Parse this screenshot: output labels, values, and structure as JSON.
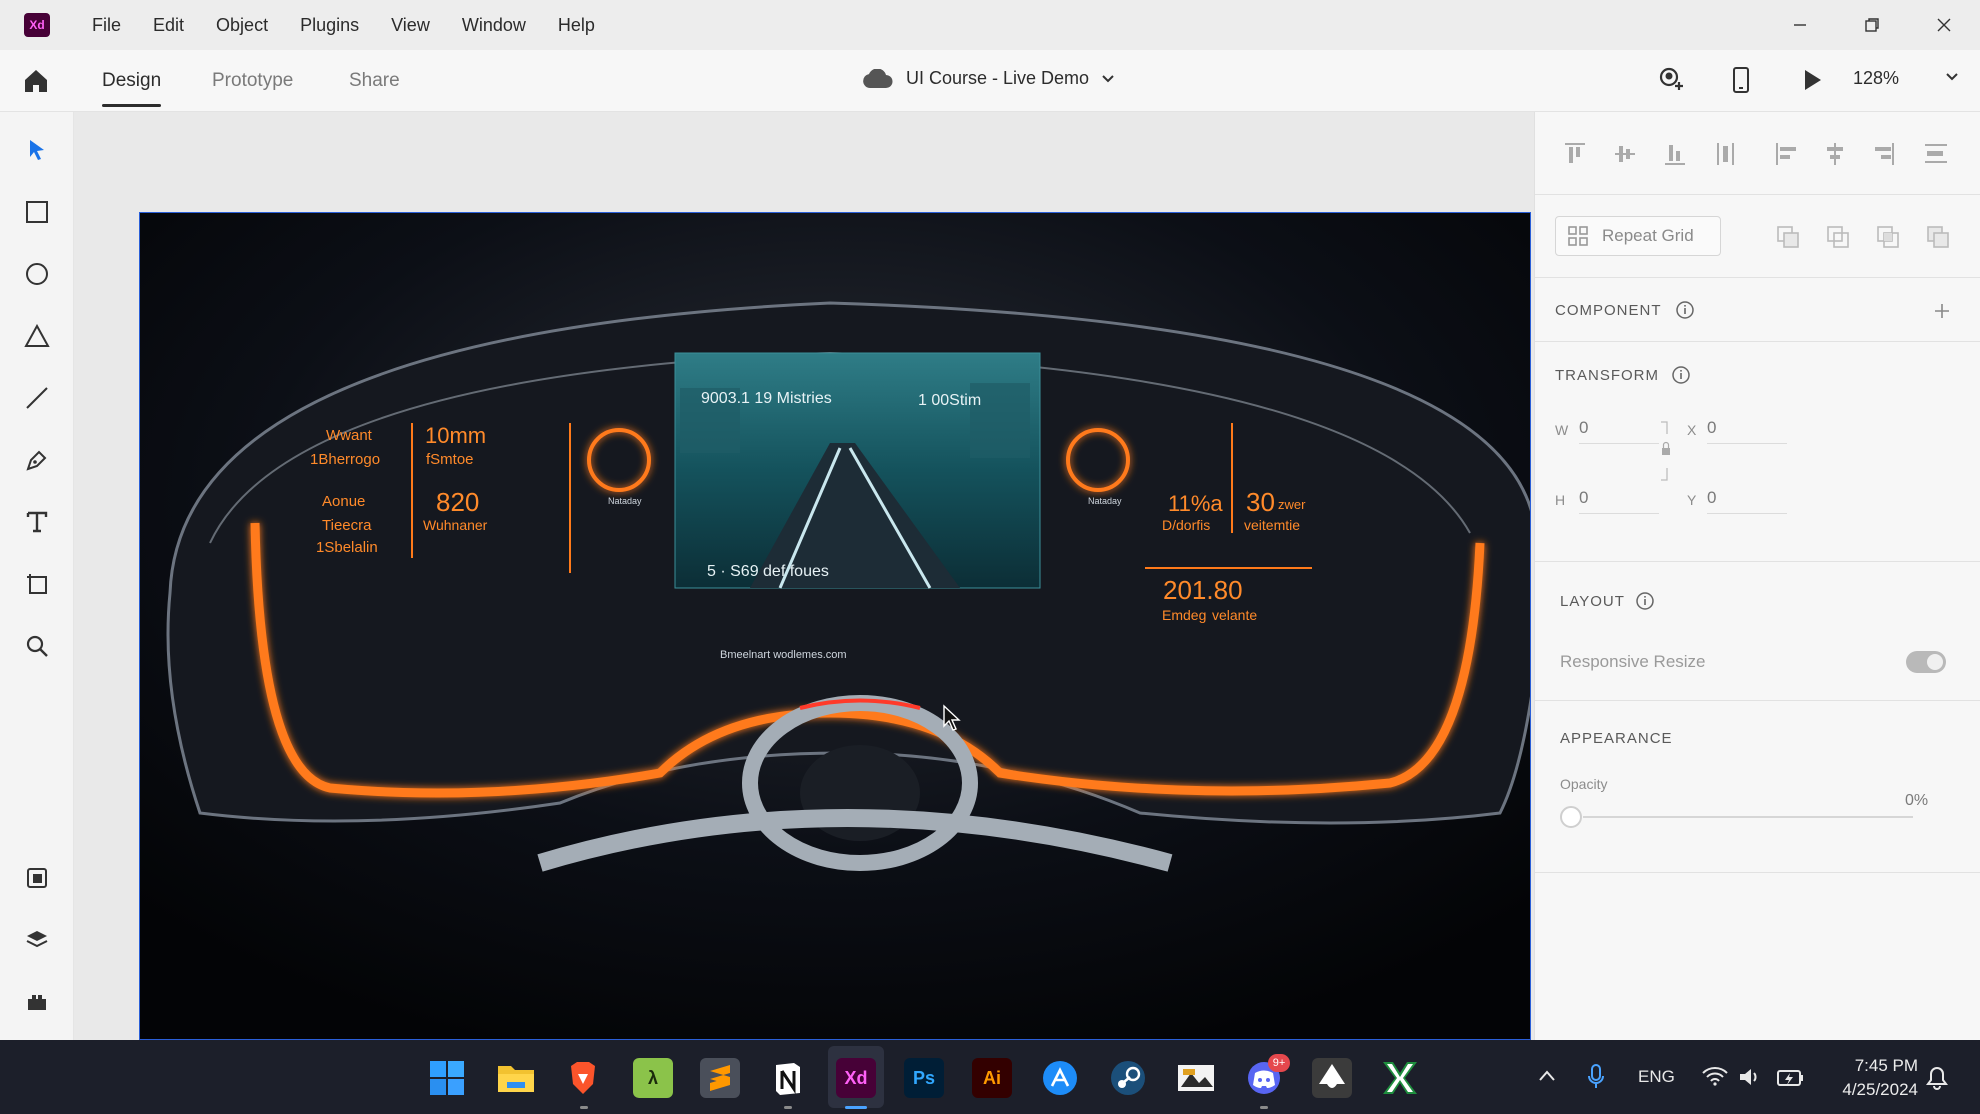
{
  "app": {
    "logo_text": "Xd"
  },
  "menu": [
    "File",
    "Edit",
    "Object",
    "Plugins",
    "View",
    "Window",
    "Help"
  ],
  "header": {
    "tabs": [
      "Design",
      "Prototype",
      "Share"
    ],
    "active_tab": "Design",
    "document_title": "UI Course - Live Demo",
    "zoom": "128%"
  },
  "tools": [
    "select-tool",
    "rectangle-tool",
    "ellipse-tool",
    "polygon-tool",
    "line-tool",
    "pen-tool",
    "text-tool",
    "artboard-tool",
    "zoom-tool",
    "assets",
    "layers",
    "plugins"
  ],
  "panel": {
    "repeat_grid": "Repeat Grid",
    "component_title": "COMPONENT",
    "transform_title": "TRANSFORM",
    "w_label": "W",
    "w_value": "0",
    "h_label": "H",
    "h_value": "0",
    "x_label": "X",
    "x_value": "0",
    "y_label": "Y",
    "y_value": "0",
    "layout_title": "LAYOUT",
    "responsive_resize": "Responsive Resize",
    "appearance_title": "APPEARANCE",
    "opacity_label": "Opacity",
    "opacity_value": "0%"
  },
  "artboard": {
    "hud_left_1": "Wwant",
    "hud_left_2": "1Bherrogo",
    "hud_left_3": "10mm",
    "hud_left_4": "fSmtoe",
    "hud_left_5": "Aonue",
    "hud_left_6": "Tieecra",
    "hud_left_7": "1Sbelalin",
    "hud_left_8": "820",
    "hud_left_9": "Wuhnaner",
    "gauge_left_label": "Nataday",
    "gauge_right_label": "Nataday",
    "screen_top_left": "9003.1 19 Mistries",
    "screen_top_right": "1 00Stim",
    "screen_bottom": "5 · S69 def foues",
    "hud_right_1": "11%a",
    "hud_right_2": "D/dorfis",
    "hud_right_3": "30",
    "hud_right_4": "zwer",
    "hud_right_5": "veitemtie",
    "hud_right_6": "201.80",
    "hud_right_7": "Emdeg",
    "hud_right_8": "velante",
    "console_caption": "Bmeelnart wodlemes.com",
    "colors": {
      "glow": "#ff7a1a",
      "screen": "#1b6b78"
    }
  },
  "taskbar": {
    "apps": [
      "start",
      "file-explorer",
      "brave",
      "lambda",
      "sublime",
      "notion",
      "adobe-xd",
      "photoshop",
      "illustrator",
      "app-store",
      "steam",
      "media",
      "discord",
      "inkscape",
      "excel"
    ],
    "discord_badge": "9+",
    "language": "ENG",
    "time": "7:45 PM",
    "date": "4/25/2024"
  }
}
